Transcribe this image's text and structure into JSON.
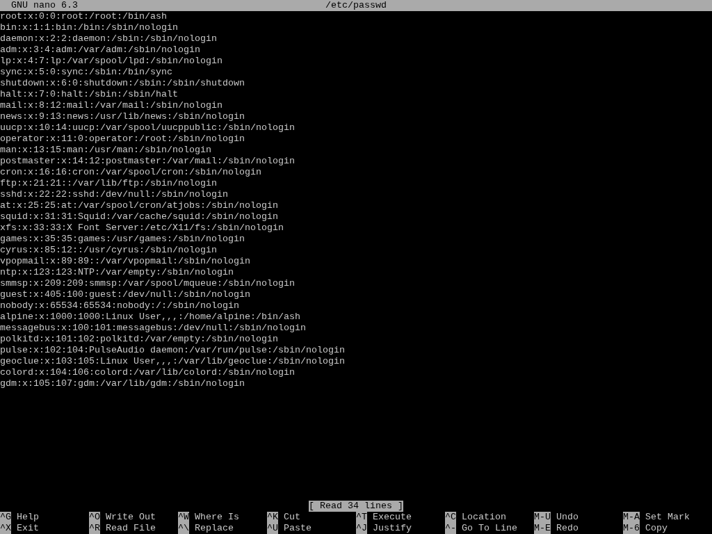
{
  "title_bar": {
    "app": "GNU nano 6.3",
    "file": "/etc/passwd"
  },
  "lines": [
    "root:x:0:0:root:/root:/bin/ash",
    "bin:x:1:1:bin:/bin:/sbin/nologin",
    "daemon:x:2:2:daemon:/sbin:/sbin/nologin",
    "adm:x:3:4:adm:/var/adm:/sbin/nologin",
    "lp:x:4:7:lp:/var/spool/lpd:/sbin/nologin",
    "sync:x:5:0:sync:/sbin:/bin/sync",
    "shutdown:x:6:0:shutdown:/sbin:/sbin/shutdown",
    "halt:x:7:0:halt:/sbin:/sbin/halt",
    "mail:x:8:12:mail:/var/mail:/sbin/nologin",
    "news:x:9:13:news:/usr/lib/news:/sbin/nologin",
    "uucp:x:10:14:uucp:/var/spool/uucppublic:/sbin/nologin",
    "operator:x:11:0:operator:/root:/sbin/nologin",
    "man:x:13:15:man:/usr/man:/sbin/nologin",
    "postmaster:x:14:12:postmaster:/var/mail:/sbin/nologin",
    "cron:x:16:16:cron:/var/spool/cron:/sbin/nologin",
    "ftp:x:21:21::/var/lib/ftp:/sbin/nologin",
    "sshd:x:22:22:sshd:/dev/null:/sbin/nologin",
    "at:x:25:25:at:/var/spool/cron/atjobs:/sbin/nologin",
    "squid:x:31:31:Squid:/var/cache/squid:/sbin/nologin",
    "xfs:x:33:33:X Font Server:/etc/X11/fs:/sbin/nologin",
    "games:x:35:35:games:/usr/games:/sbin/nologin",
    "cyrus:x:85:12::/usr/cyrus:/sbin/nologin",
    "vpopmail:x:89:89::/var/vpopmail:/sbin/nologin",
    "ntp:x:123:123:NTP:/var/empty:/sbin/nologin",
    "smmsp:x:209:209:smmsp:/var/spool/mqueue:/sbin/nologin",
    "guest:x:405:100:guest:/dev/null:/sbin/nologin",
    "nobody:x:65534:65534:nobody:/:/sbin/nologin",
    "alpine:x:1000:1000:Linux User,,,:/home/alpine:/bin/ash",
    "messagebus:x:100:101:messagebus:/dev/null:/sbin/nologin",
    "polkitd:x:101:102:polkitd:/var/empty:/sbin/nologin",
    "pulse:x:102:104:PulseAudio daemon:/var/run/pulse:/sbin/nologin",
    "geoclue:x:103:105:Linux User,,,:/var/lib/geoclue:/sbin/nologin",
    "colord:x:104:106:colord:/var/lib/colord:/sbin/nologin",
    "gdm:x:105:107:gdm:/var/lib/gdm:/sbin/nologin"
  ],
  "status": "[ Read 34 lines ]",
  "shortcuts": [
    [
      {
        "key": "^G",
        "label": "Help"
      },
      {
        "key": "^O",
        "label": "Write Out"
      },
      {
        "key": "^W",
        "label": "Where Is"
      },
      {
        "key": "^K",
        "label": "Cut"
      },
      {
        "key": "^T",
        "label": "Execute"
      },
      {
        "key": "^C",
        "label": "Location"
      },
      {
        "key": "M-U",
        "label": "Undo"
      },
      {
        "key": "M-A",
        "label": "Set Mark"
      }
    ],
    [
      {
        "key": "^X",
        "label": "Exit"
      },
      {
        "key": "^R",
        "label": "Read File"
      },
      {
        "key": "^\\",
        "label": "Replace"
      },
      {
        "key": "^U",
        "label": "Paste"
      },
      {
        "key": "^J",
        "label": "Justify"
      },
      {
        "key": "^-",
        "label": "Go To Line"
      },
      {
        "key": "M-E",
        "label": "Redo"
      },
      {
        "key": "M-6",
        "label": "Copy"
      }
    ]
  ]
}
